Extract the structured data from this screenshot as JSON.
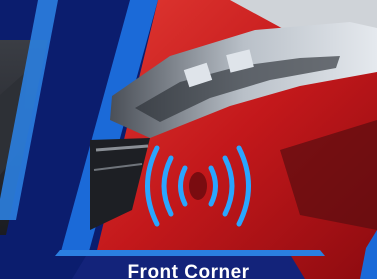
{
  "caption": {
    "title": "Front Corner"
  },
  "icons": {
    "sensor": "sensor-waves-icon"
  },
  "colors": {
    "brand_blue": "#0b1d6e",
    "accent_blue": "#1e90ff",
    "car_red": "#c81e1e"
  }
}
